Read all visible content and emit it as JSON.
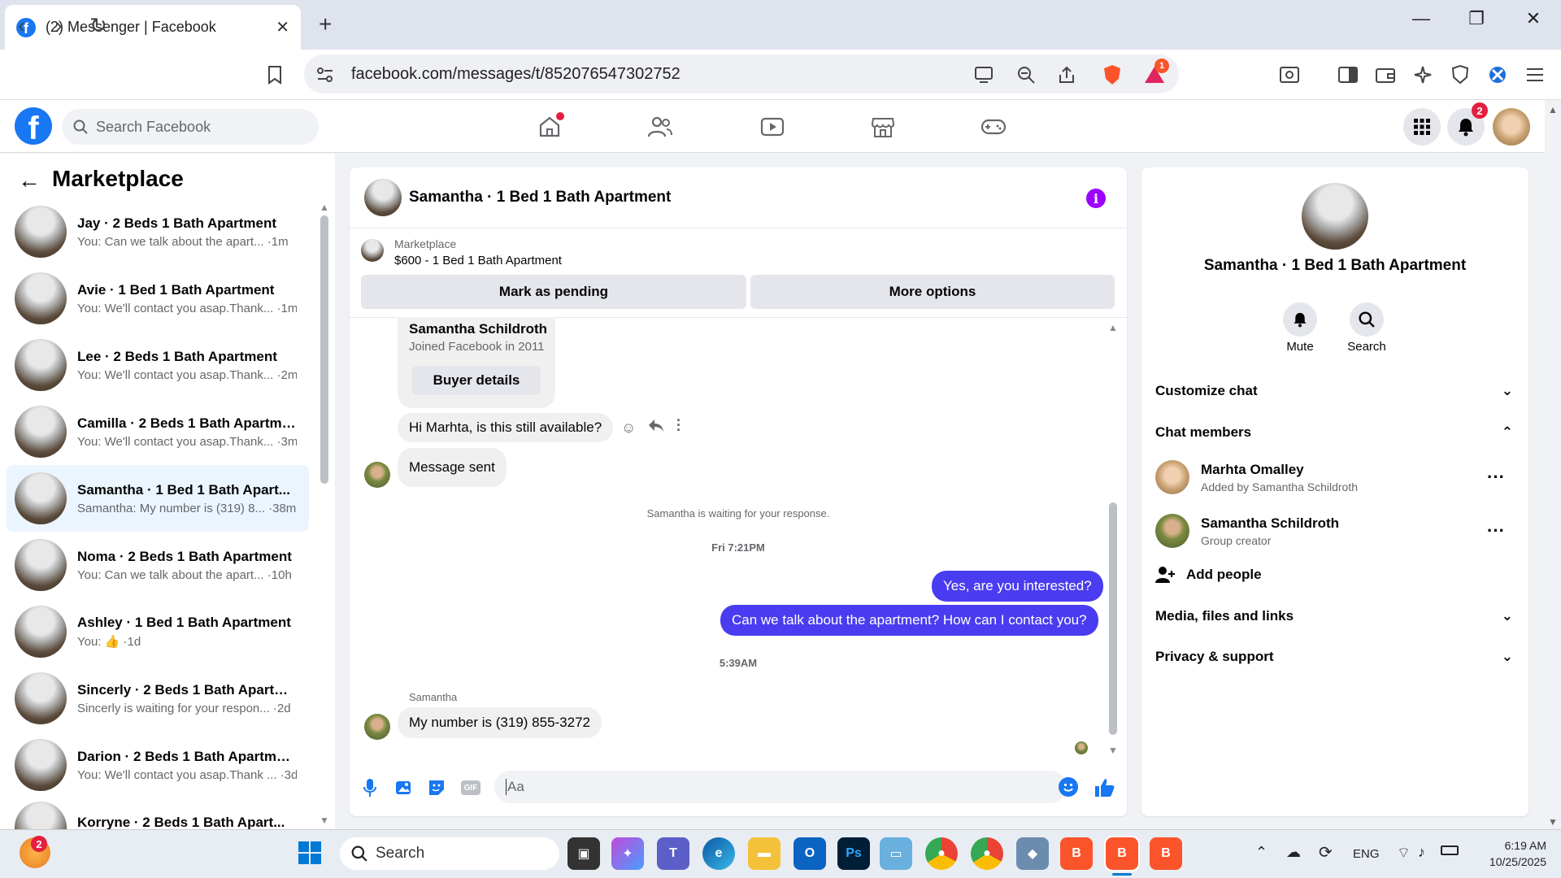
{
  "browser": {
    "tab_title": "(2) Messenger | Facebook",
    "url": "facebook.com/messages/t/852076547302752",
    "brave_rewards_badge": "1"
  },
  "fb": {
    "search_placeholder": "Search Facebook",
    "notifications_count": "2"
  },
  "sidebar": {
    "title": "Marketplace",
    "conversations": [
      {
        "name": "Jay · 2 Beds 1 Bath Apartment",
        "preview": "You: Can we talk about the apart... ·1m"
      },
      {
        "name": "Avie · 1 Bed 1 Bath Apartment",
        "preview": "You: We'll contact you asap.Thank... ·1m"
      },
      {
        "name": "Lee · 2 Beds 1 Bath Apartment",
        "preview": "You: We'll contact you asap.Thank... ·2m"
      },
      {
        "name": "Camilla · 2 Beds 1 Bath Apartme...",
        "preview": "You: We'll contact you asap.Thank... ·3m"
      },
      {
        "name": "Samantha · 1 Bed 1 Bath Apart...",
        "preview": "Samantha: My number is (319) 8... ·38m"
      },
      {
        "name": "Noma · 2 Beds 1 Bath Apartment",
        "preview": "You: Can we talk about the apart... ·10h"
      },
      {
        "name": "Ashley · 1 Bed 1 Bath Apartment",
        "preview": "You: 👍 ·1d"
      },
      {
        "name": "Sincerly · 2 Beds 1 Bath Apartm...",
        "preview": "Sincerly is waiting for your respon... ·2d"
      },
      {
        "name": "Darion · 2 Beds 1 Bath Apartment",
        "preview": "You: We'll contact you asap.Thank ... ·3d"
      },
      {
        "name": "Korryne · 2 Beds 1 Bath Apart...",
        "preview": ""
      }
    ]
  },
  "chat": {
    "title": "Samantha · 1 Bed 1 Bath Apartment",
    "marketplace_label": "Marketplace",
    "listing": "$600 - 1 Bed 1 Bath Apartment",
    "mark_pending": "Mark as pending",
    "more_options": "More options",
    "buyer_name": "Samantha Schildroth",
    "buyer_joined": "Joined Facebook in 2011",
    "buyer_details": "Buyer details",
    "msg1": "Hi Marhta, is this still available?",
    "msg2": "Message sent",
    "waiting": "Samantha is waiting for your response.",
    "time1": "Fri 7:21PM",
    "out1": "Yes, are you interested?",
    "out2": "Can we talk about the apartment? How can I contact you?",
    "time2": "5:39AM",
    "sender": "Samantha",
    "msg3": "My number is (319) 855-3272",
    "compose_placeholder": "Aa"
  },
  "info": {
    "title": "Samantha · 1 Bed 1 Bath Apartment",
    "mute": "Mute",
    "search": "Search",
    "customize": "Customize chat",
    "members": "Chat members",
    "member1_name": "Marhta Omalley",
    "member1_sub": "Added by Samantha Schildroth",
    "member2_name": "Samantha Schildroth",
    "member2_sub": "Group creator",
    "add_people": "Add people",
    "media": "Media, files and links",
    "privacy": "Privacy & support"
  },
  "taskbar": {
    "search": "Search",
    "lang": "ENG",
    "time": "6:19 AM",
    "date": "10/25/2025",
    "weather_badge": "2"
  }
}
